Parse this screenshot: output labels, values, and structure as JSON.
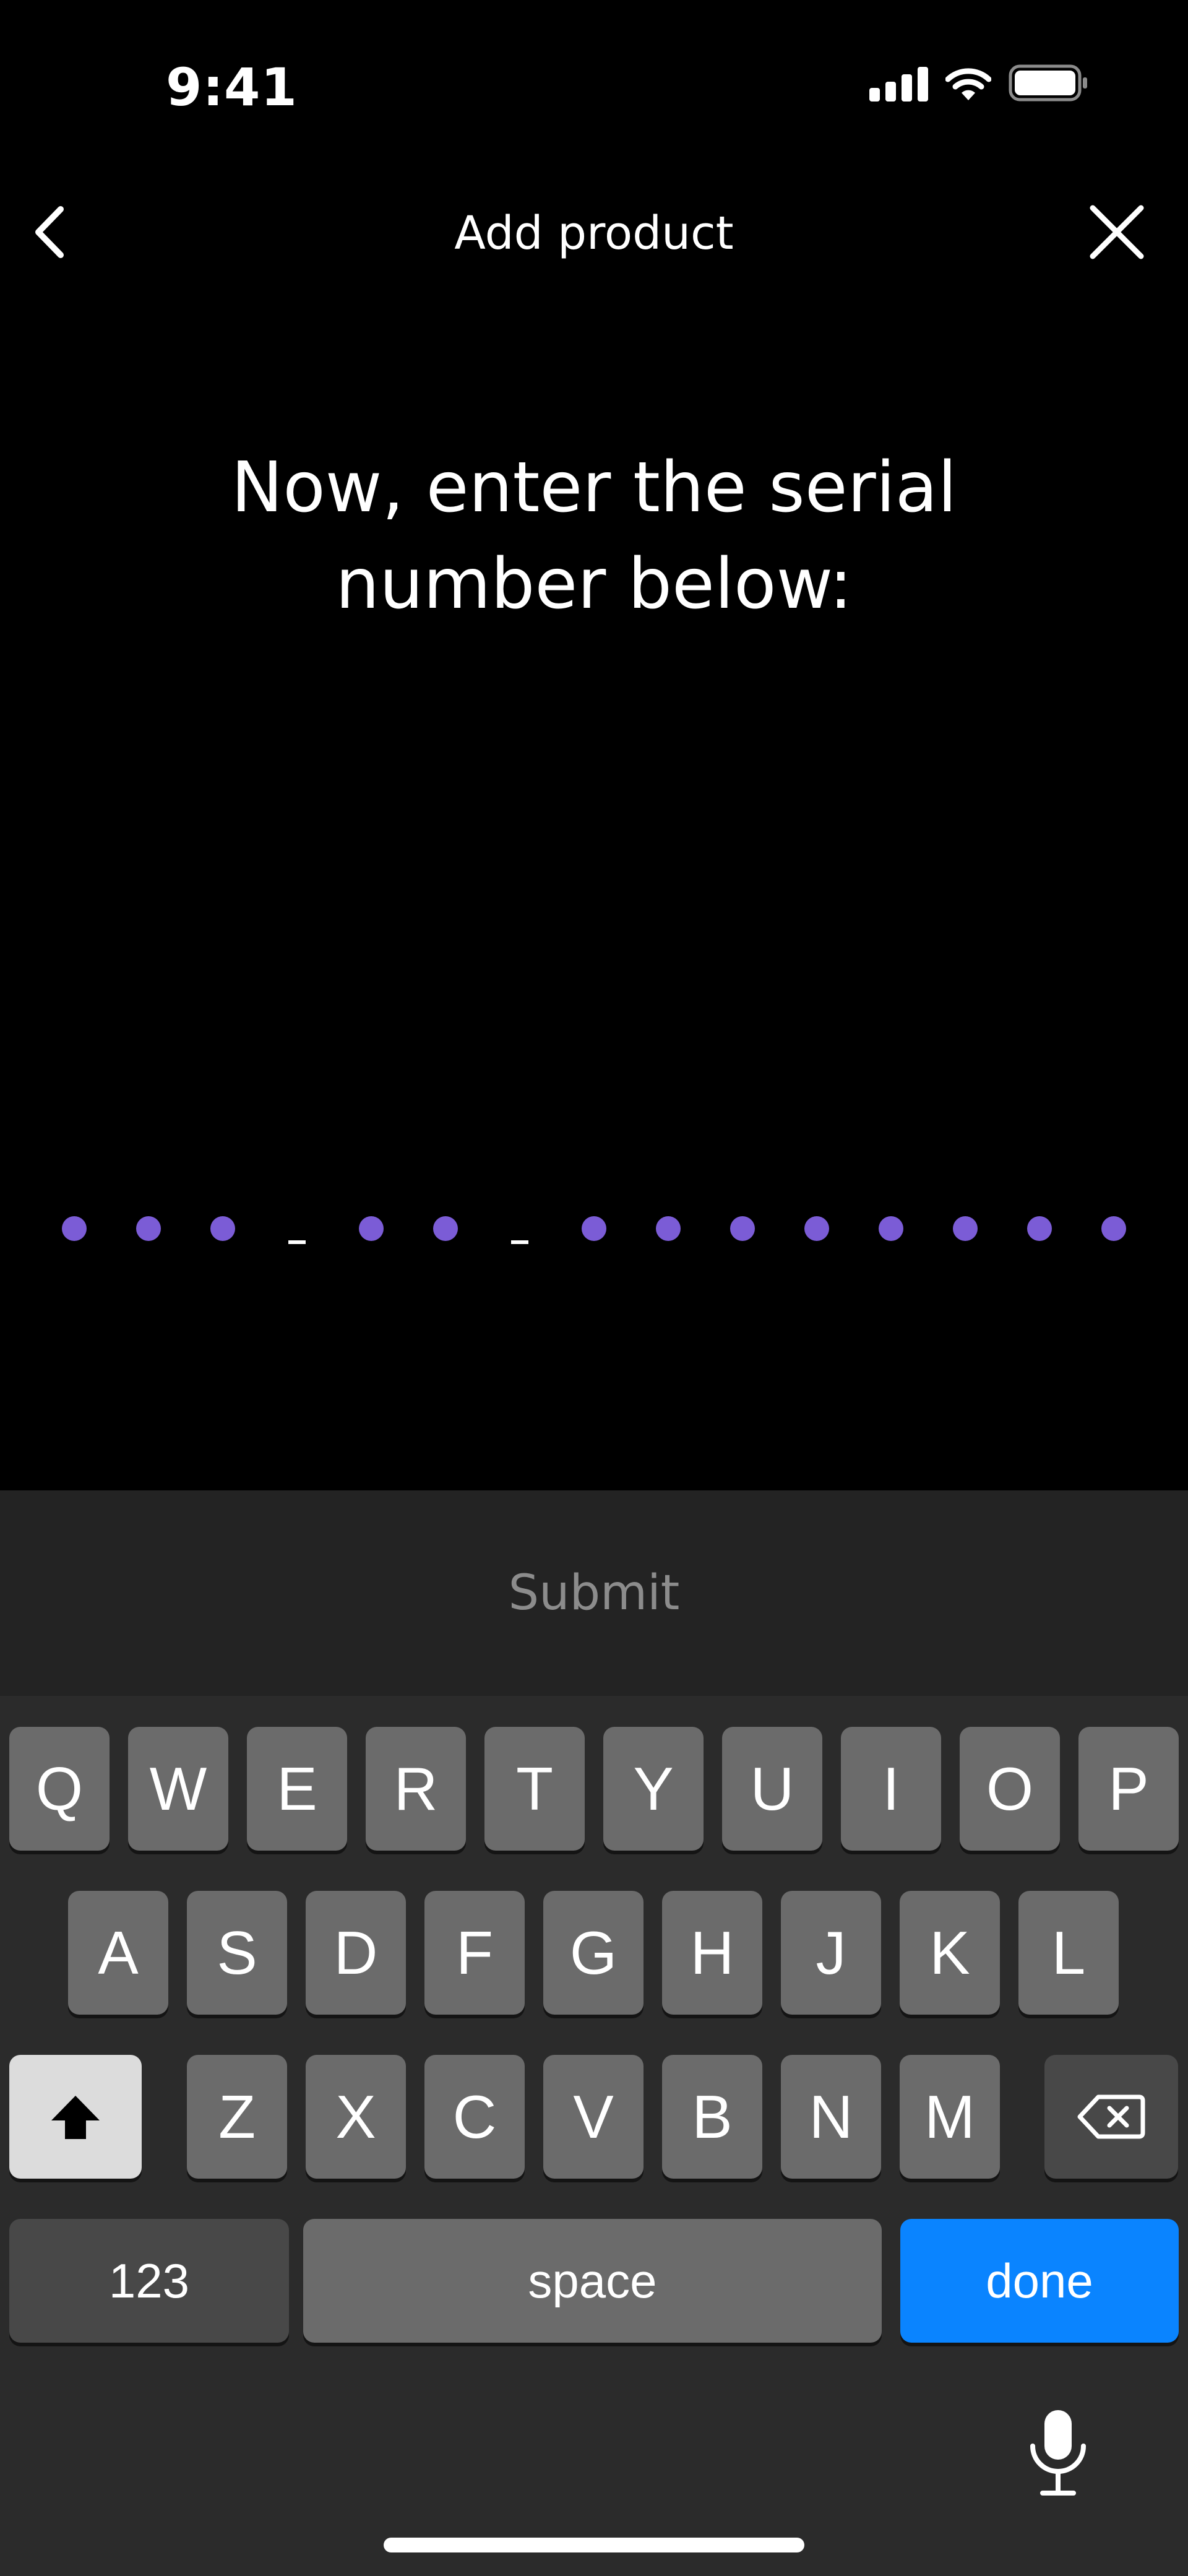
{
  "status_bar": {
    "time": "9:41",
    "icons": [
      "cellular-signal-icon",
      "wifi-icon",
      "battery-icon"
    ]
  },
  "header": {
    "title": "Add product",
    "back_icon": "chevron-left-icon",
    "close_icon": "close-icon"
  },
  "main": {
    "heading_line1": "Now, enter the serial",
    "heading_line2": "number below:"
  },
  "serial_input": {
    "placeholder_color": "#7b5cd6",
    "pattern": [
      "dot",
      "dot",
      "dot",
      "dash",
      "dot",
      "dot",
      "dash",
      "dot",
      "dot",
      "dot",
      "dot",
      "dot",
      "dot",
      "dot",
      "dot"
    ]
  },
  "submit": {
    "label": "Submit",
    "enabled": false
  },
  "keyboard": {
    "row1": [
      "Q",
      "W",
      "E",
      "R",
      "T",
      "Y",
      "U",
      "I",
      "O",
      "P"
    ],
    "row2": [
      "A",
      "S",
      "D",
      "F",
      "G",
      "H",
      "J",
      "K",
      "L"
    ],
    "row3": [
      "Z",
      "X",
      "C",
      "V",
      "B",
      "N",
      "M"
    ],
    "shift_icon": "shift-icon",
    "backspace_icon": "backspace-icon",
    "numbers_label": "123",
    "space_label": "space",
    "done_label": "done",
    "mic_icon": "microphone-icon"
  },
  "colors": {
    "background": "#000000",
    "accent": "#7b5cd6",
    "done_blue": "#0a84ff"
  }
}
